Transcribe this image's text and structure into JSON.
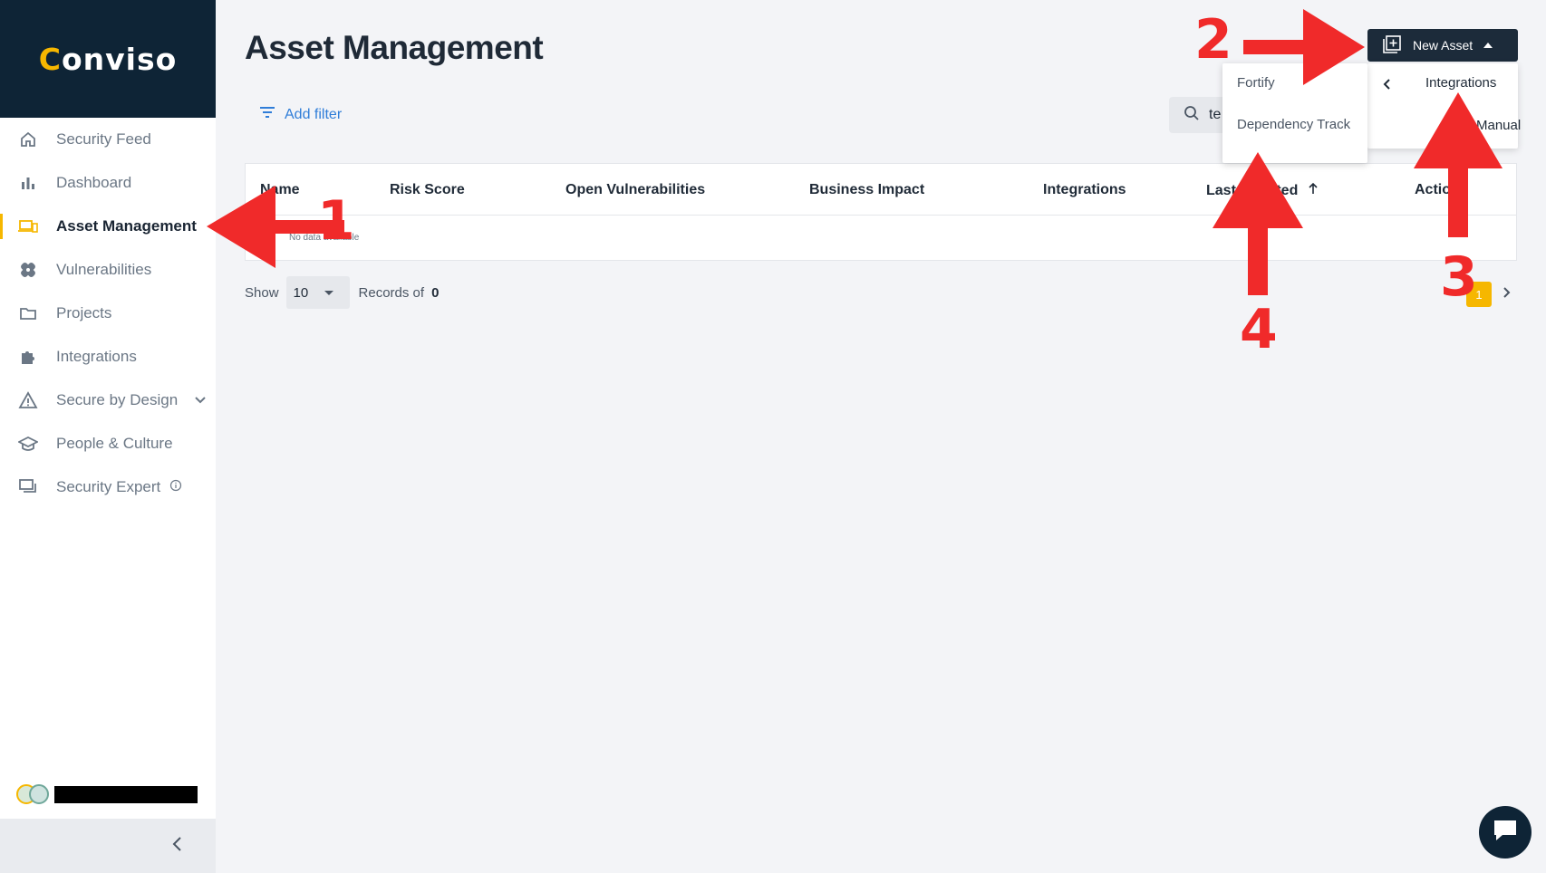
{
  "sidebar": {
    "logo": "conviso",
    "items": [
      {
        "label": "Security Feed",
        "icon": "home-icon"
      },
      {
        "label": "Dashboard",
        "icon": "bar-chart-icon"
      },
      {
        "label": "Asset Management",
        "icon": "devices-icon",
        "active": true
      },
      {
        "label": "Vulnerabilities",
        "icon": "bandage-icon"
      },
      {
        "label": "Projects",
        "icon": "folder-icon"
      },
      {
        "label": "Integrations",
        "icon": "puzzle-icon"
      },
      {
        "label": "Secure by Design",
        "icon": "warning-icon"
      },
      {
        "label": "People & Culture",
        "icon": "graduation-cap-icon"
      },
      {
        "label": "Security Expert",
        "icon": "chat-icon"
      }
    ]
  },
  "main": {
    "title": "Asset Management",
    "add_filter_label": "Add filter",
    "search_value": "te",
    "columns": [
      "Name",
      "Risk Score",
      "Open Vulnerabilities",
      "Business Impact",
      "Integrations",
      "Last Updated",
      "Actions"
    ],
    "no_data": "No data available",
    "show_label": "Show",
    "page_size": "10",
    "records_label": "Records of",
    "records_count": "0",
    "current_page": "1"
  },
  "new_asset": {
    "label": "New Asset",
    "submenu": {
      "integrations": "Integrations",
      "manual": "Manual"
    },
    "dropdown": {
      "option1": "Fortify",
      "option2": "Dependency Track"
    }
  },
  "annotations": [
    "1",
    "2",
    "3",
    "4"
  ],
  "colors": {
    "accent": "#f6b700",
    "annotation": "#f02a2a",
    "navy": "#0e2436",
    "link": "#2f7dd8"
  }
}
